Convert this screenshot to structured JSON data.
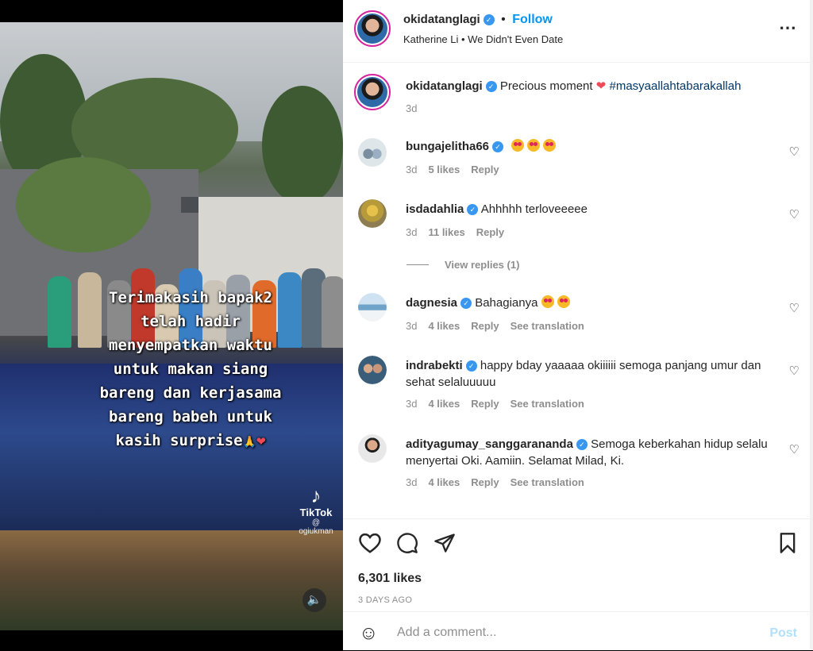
{
  "post": {
    "author": "okidatanglagi",
    "follow_label": "Follow",
    "dot": "•",
    "audio": "Katherine Li • We Didn't Even Date",
    "more_icon": "more-horizontal-icon"
  },
  "video": {
    "overlay_lines": [
      "Terimakasih bapak2",
      "telah hadir",
      "menyempatkan waktu",
      "untuk makan siang",
      "bareng dan kerjasama",
      "bareng  babeh untuk",
      "kasih surprise"
    ],
    "tiktok_label": "TikTok",
    "tiktok_handle": "@ ogiukman"
  },
  "caption": {
    "username": "okidatanglagi",
    "text": "Precious moment",
    "hashtag": "#masyaallahtabarakallah",
    "time": "3d"
  },
  "comments": [
    {
      "username": "bungajelitha66",
      "text": "",
      "emoji_count": 3,
      "time": "3d",
      "likes": "5 likes",
      "reply": "Reply",
      "translate": ""
    },
    {
      "username": "isdadahlia",
      "text": "Ahhhhh terloveeeee",
      "emoji_count": 0,
      "time": "3d",
      "likes": "11 likes",
      "reply": "Reply",
      "translate": ""
    },
    {
      "username": "dagnesia",
      "text": "Bahagianya",
      "emoji_count": 2,
      "time": "3d",
      "likes": "4 likes",
      "reply": "Reply",
      "translate": "See translation"
    },
    {
      "username": "indrabekti",
      "text": "happy bday yaaaaa okiiiiii semoga panjang umur dan sehat selaluuuuu",
      "emoji_count": 0,
      "time": "3d",
      "likes": "4 likes",
      "reply": "Reply",
      "translate": "See translation"
    },
    {
      "username": "adityagumay_sanggarananda",
      "text": "Semoga keberkahan hidup selalu menyertai Oki. Aamiin. Selamat Milad, Ki.",
      "emoji_count": 0,
      "time": "3d",
      "likes": "4 likes",
      "reply": "Reply",
      "translate": "See translation"
    }
  ],
  "view_replies": "View replies (1)",
  "footer": {
    "likes": "6,301 likes",
    "ago": "3 DAYS AGO",
    "comment_placeholder": "Add a comment...",
    "post_label": "Post"
  },
  "colors": {
    "accent": "#0095f6",
    "verified": "#3897f0",
    "heart": "#ed4956"
  }
}
